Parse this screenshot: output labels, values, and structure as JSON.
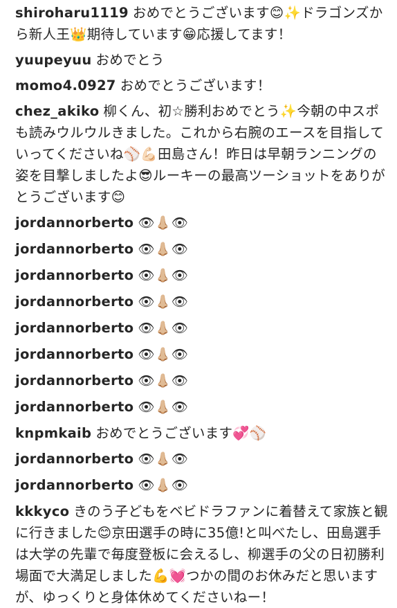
{
  "comments": [
    {
      "user": "shiroharu1119",
      "text": "おめでとうございます😊✨ドラゴンズから新人王👑期待しています😁応援してます！"
    },
    {
      "user": "yuupeyuu",
      "text": "おめでとう"
    },
    {
      "user": "momo4.0927",
      "text": "おめでとうございます！"
    },
    {
      "user": "chez_akiko",
      "text": "柳くん、初☆勝利おめでとう✨今朝の中スポも読みウルウルきました。これから右腕のエースを目指していってくださいね⚾💪🏻田島さん！昨日は早朝ランニングの姿を目撃しましたよ😎ルーキーの最高ツーショットをありがとうございます😊"
    },
    {
      "user": "jordannorberto",
      "text": "👁👃🏼👁"
    },
    {
      "user": "jordannorberto",
      "text": "👁👃🏼👁"
    },
    {
      "user": "jordannorberto",
      "text": "👁👃🏼👁"
    },
    {
      "user": "jordannorberto",
      "text": "👁👃🏼👁"
    },
    {
      "user": "jordannorberto",
      "text": "👁👃🏼👁"
    },
    {
      "user": "jordannorberto",
      "text": "👁👃🏼👁"
    },
    {
      "user": "jordannorberto",
      "text": "👁👃🏼👁"
    },
    {
      "user": "jordannorberto",
      "text": "👁👃🏼👁"
    },
    {
      "user": "knpmkaib",
      "text": "おめでとうございます💞⚾"
    },
    {
      "user": "jordannorberto",
      "text": "👁👃🏼👁"
    },
    {
      "user": "jordannorberto",
      "text": "👁👃🏼👁"
    },
    {
      "user": "kkkyco",
      "text": "きのう子どもをベビドラファンに着替えて家族と観に行きました😊京田選手の時に35億!と叫べたし、田島選手は大学の先輩で毎度登板に会えるし、柳選手の父の日初勝利場面で大満足しました💪💓つかの間のお休みだと思いますが、ゆっくりと身体休めてくださいねー！"
    }
  ]
}
